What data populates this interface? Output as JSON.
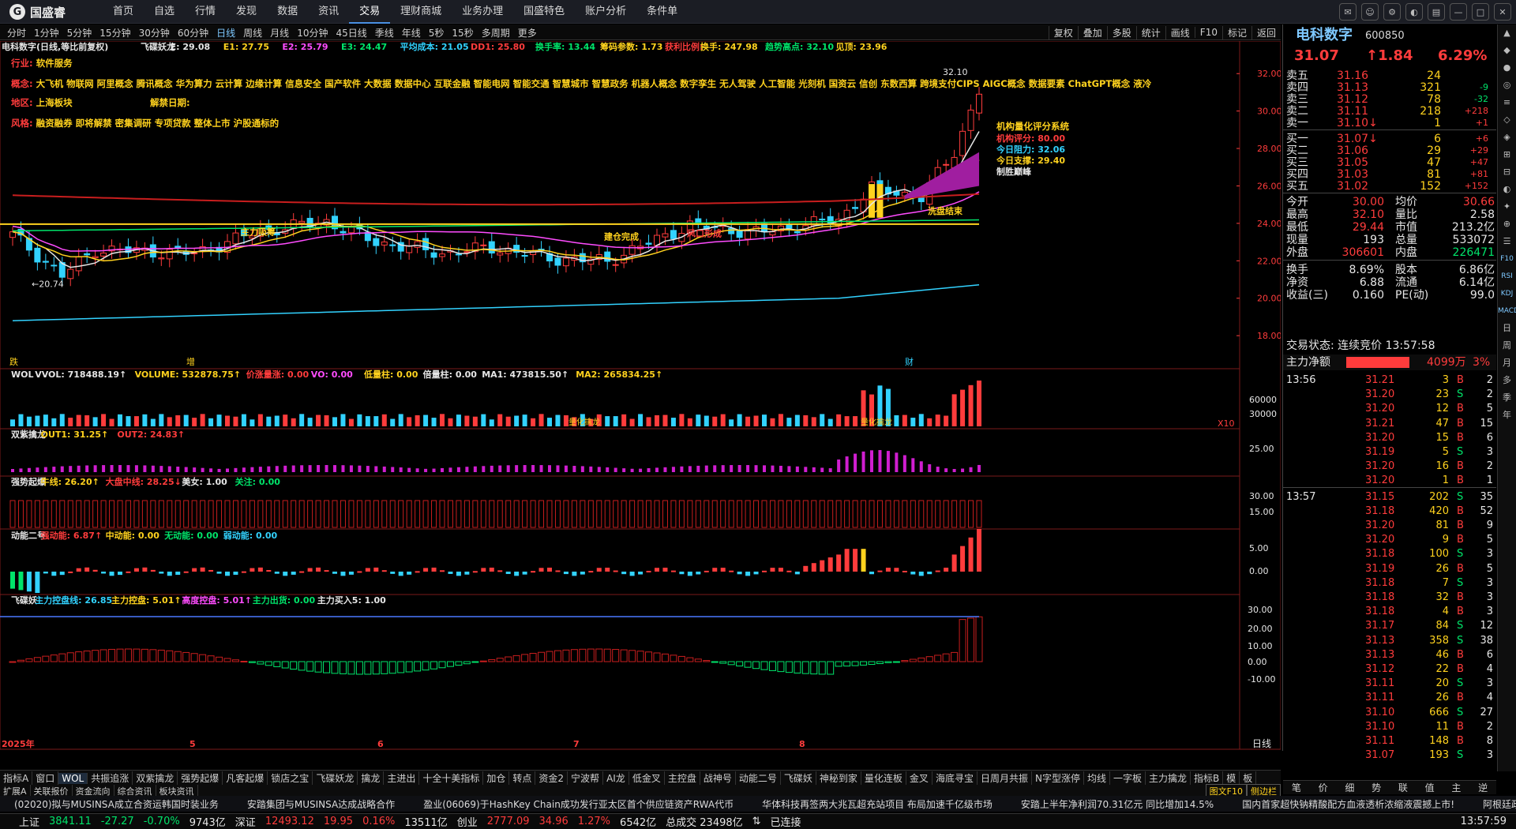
{
  "app": {
    "name": "国盛睿"
  },
  "topmenu": [
    "首页",
    "自选",
    "行情",
    "发现",
    "数据",
    "资讯",
    "交易",
    "理财商城",
    "业务办理",
    "国盛特色",
    "账户分析",
    "条件单"
  ],
  "periods": [
    "分时",
    "1分钟",
    "5分钟",
    "15分钟",
    "30分钟",
    "60分钟",
    "日线",
    "周线",
    "月线",
    "10分钟",
    "45日线",
    "季线",
    "年线",
    "5秒",
    "15秒",
    "多周期",
    "更多"
  ],
  "tools": [
    "复权",
    "叠加",
    "多股",
    "统计",
    "画线",
    "F10",
    "标记",
    "返回"
  ],
  "chart": {
    "title": "电科数字(日线,等比前复权)",
    "indicator_main": [
      {
        "t": "飞碟妖龙",
        "c": "#e6e6e6"
      },
      {
        "t": "E: 29.08",
        "c": "#e6e6e6"
      },
      {
        "t": "E1: 27.75",
        "c": "#ffd21e"
      },
      {
        "t": "E2: 25.79",
        "c": "#ff4cff"
      },
      {
        "t": "E3: 24.47",
        "c": "#00e46a"
      },
      {
        "t": "平均成本: 21.05",
        "c": "#32d2ff"
      },
      {
        "t": "DD1: 25.80",
        "c": "#ff3c3c"
      },
      {
        "t": "换手率: 13.44",
        "c": "#00e46a"
      },
      {
        "t": "筹码参数: 1.73",
        "c": "#ffd21e"
      },
      {
        "t": "获利比例:",
        "c": "#ff3c3c"
      },
      {
        "t": "换手: 247.98",
        "c": "#ffd21e"
      },
      {
        "t": "趋势高点: 32.10",
        "c": "#00e46a"
      },
      {
        "t": "见顶: 23.96",
        "c": "#ffd21e"
      }
    ],
    "info": {
      "industry": "行业: 软件服务",
      "concepts": "概念: 大飞机 物联网 阿里概念 腾讯概念 华为算力 云计算 边缘计算 信息安全 国产软件 大数据 数据中心 互联金融 智能电网 智能交通 智慧城市 智慧政务 机器人概念 数字孪生 无人驾驶 人工智能 光刻机 国资云 信创 东数西算 跨境支付CIPS AIGC概念 数据要素 ChatGPT概念 液冷",
      "region": "地区: 上海板块",
      "unlock": "解禁日期:",
      "style": "风格: 融资融券 即将解禁 密集调研 专项贷款 整体上市 沪股通标的"
    },
    "rating": {
      "title": "机构量化评分系统",
      "score": "机构评分: 80.00",
      "resist": "今日阻力: 32.06",
      "support": "今日支撑: 29.40",
      "note": "制胜巅峰"
    },
    "annotations": [
      "主力吸筹",
      "建仓完成",
      "风口形成",
      "洗盘结束",
      "←20.74",
      "32.10"
    ],
    "bottom_marks": [
      "跌",
      "增",
      "财"
    ],
    "price_axis": [
      "32.00",
      "30.00",
      "28.00",
      "26.00",
      "24.00",
      "22.00",
      "20.00",
      "18.00"
    ],
    "vol_legend": [
      {
        "t": "WOL",
        "c": "#e6e6e6"
      },
      {
        "t": "VVOL: 718488.19↑",
        "c": "#e6e6e6"
      },
      {
        "t": "VOLUME: 532878.75↑",
        "c": "#ffd21e"
      },
      {
        "t": "价涨量涨: 0.00",
        "c": "#ff3c3c"
      },
      {
        "t": "VO: 0.00",
        "c": "#ff4cff"
      },
      {
        "t": "低量柱: 0.00",
        "c": "#ffd21e"
      },
      {
        "t": "倍量柱: 0.00",
        "c": "#e6e6e6"
      },
      {
        "t": "MA1: 473815.50↑",
        "c": "#e6e6e6"
      },
      {
        "t": "MA2: 265834.25↑",
        "c": "#ffd21e"
      }
    ],
    "vol_axis": [
      "60000",
      "30000",
      "X10"
    ],
    "vol_marks": [
      "量化擒龙",
      "量化擒龙"
    ],
    "p3_legend": [
      {
        "t": "双紫擒龙",
        "c": "#e6e6e6"
      },
      {
        "t": "OUT1: 31.25↑",
        "c": "#ffd21e"
      },
      {
        "t": "OUT2: 24.83↑",
        "c": "#ff3c3c"
      }
    ],
    "p3_axis": [
      "25.00"
    ],
    "p4_legend": [
      {
        "t": "强势起爆",
        "c": "#e6e6e6"
      },
      {
        "t": "牛线: 26.20↑",
        "c": "#ffd21e"
      },
      {
        "t": "大盘中线: 28.25↓",
        "c": "#ff3c3c"
      },
      {
        "t": "美女: 1.00",
        "c": "#e6e6e6"
      },
      {
        "t": "关注: 0.00",
        "c": "#00e46a"
      }
    ],
    "p4_axis": [
      "30.00",
      "15.00"
    ],
    "p5_legend": [
      {
        "t": "动能二号",
        "c": "#e6e6e6"
      },
      {
        "t": "强动能: 6.87↑",
        "c": "#ff3c3c"
      },
      {
        "t": "中动能: 0.00",
        "c": "#ffd21e"
      },
      {
        "t": "无动能: 0.00",
        "c": "#00e46a"
      },
      {
        "t": "弱动能: 0.00",
        "c": "#32d2ff"
      }
    ],
    "p5_axis": [
      "5.00",
      "0.00"
    ],
    "p6_legend": [
      {
        "t": "飞碟妖",
        "c": "#e6e6e6"
      },
      {
        "t": "主力控盘线: 26.85",
        "c": "#32d2ff"
      },
      {
        "t": "主力控盘: 5.01↑",
        "c": "#ffd21e"
      },
      {
        "t": "高度控盘: 5.01↑",
        "c": "#ff4cff"
      },
      {
        "t": "主力出货: 0.00",
        "c": "#00e46a"
      },
      {
        "t": "主力买入5: 1.00",
        "c": "#e6e6e6"
      }
    ],
    "p6_axis": [
      "30.00",
      "20.00",
      "10.00",
      "0.00",
      "-10.00"
    ],
    "date_axis": [
      "2025年",
      "5",
      "6",
      "7",
      "8"
    ],
    "period_label": "日线"
  },
  "quote": {
    "name": "电科数字",
    "code": "600850",
    "price": "31.07",
    "change": "↑1.84",
    "pct": "6.29%",
    "asks": [
      {
        "l": "卖五",
        "p": "31.16",
        "v": "24",
        "d": ""
      },
      {
        "l": "卖四",
        "p": "31.13",
        "v": "321",
        "d": "-9"
      },
      {
        "l": "卖三",
        "p": "31.12",
        "v": "78",
        "d": "-32"
      },
      {
        "l": "卖二",
        "p": "31.11",
        "v": "218",
        "d": "+218"
      },
      {
        "l": "卖一",
        "p": "31.10↓",
        "v": "1",
        "d": "+1"
      }
    ],
    "bids": [
      {
        "l": "买一",
        "p": "31.07↓",
        "v": "6",
        "d": "+6"
      },
      {
        "l": "买二",
        "p": "31.06",
        "v": "29",
        "d": "+29"
      },
      {
        "l": "买三",
        "p": "31.05",
        "v": "47",
        "d": "+47"
      },
      {
        "l": "买四",
        "p": "31.03",
        "v": "81",
        "d": "+81"
      },
      {
        "l": "买五",
        "p": "31.02",
        "v": "152",
        "d": "+152"
      }
    ],
    "stats": [
      [
        "今开",
        "30.00",
        "均价",
        "30.66"
      ],
      [
        "最高",
        "32.10",
        "量比",
        "2.58"
      ],
      [
        "最低",
        "29.44",
        "市值",
        "213.2亿"
      ],
      [
        "现量",
        "193",
        "总量",
        "533072"
      ],
      [
        "外盘",
        "306601",
        "内盘",
        "226471"
      ]
    ],
    "stats2": [
      [
        "换手",
        "8.69%",
        "股本",
        "6.86亿"
      ],
      [
        "净资",
        "6.88",
        "流通",
        "6.14亿"
      ],
      [
        "收益(三)",
        "0.160",
        "PE(动)",
        "99.0"
      ]
    ],
    "status": "交易状态: 连续竞价 13:57:58",
    "netflow_label": "主力净额",
    "netflow_value": "4099万",
    "netflow_pct": "3%",
    "ticks": [
      {
        "t": "13:56",
        "p": "31.21",
        "v": "3",
        "s": "B",
        "n": "2"
      },
      {
        "t": "",
        "p": "31.20",
        "v": "23",
        "s": "S",
        "n": "2"
      },
      {
        "t": "",
        "p": "31.20",
        "v": "12",
        "s": "B",
        "n": "5"
      },
      {
        "t": "",
        "p": "31.21",
        "v": "47",
        "s": "B",
        "n": "15"
      },
      {
        "t": "",
        "p": "31.20",
        "v": "15",
        "s": "B",
        "n": "6"
      },
      {
        "t": "",
        "p": "31.19",
        "v": "5",
        "s": "S",
        "n": "3"
      },
      {
        "t": "",
        "p": "31.20",
        "v": "16",
        "s": "B",
        "n": "2"
      },
      {
        "t": "",
        "p": "31.20",
        "v": "1",
        "s": "B",
        "n": "1"
      },
      {
        "t": "13:57",
        "p": "31.15",
        "v": "202",
        "s": "S",
        "n": "35"
      },
      {
        "t": "",
        "p": "31.18",
        "v": "420",
        "s": "B",
        "n": "52"
      },
      {
        "t": "",
        "p": "31.20",
        "v": "81",
        "s": "B",
        "n": "9"
      },
      {
        "t": "",
        "p": "31.20",
        "v": "9",
        "s": "B",
        "n": "5"
      },
      {
        "t": "",
        "p": "31.18",
        "v": "100",
        "s": "S",
        "n": "3"
      },
      {
        "t": "",
        "p": "31.19",
        "v": "26",
        "s": "B",
        "n": "5"
      },
      {
        "t": "",
        "p": "31.18",
        "v": "7",
        "s": "S",
        "n": "3"
      },
      {
        "t": "",
        "p": "31.18",
        "v": "32",
        "s": "B",
        "n": "3"
      },
      {
        "t": "",
        "p": "31.18",
        "v": "4",
        "s": "B",
        "n": "3"
      },
      {
        "t": "",
        "p": "31.17",
        "v": "84",
        "s": "S",
        "n": "12"
      },
      {
        "t": "",
        "p": "31.13",
        "v": "358",
        "s": "S",
        "n": "38"
      },
      {
        "t": "",
        "p": "31.13",
        "v": "46",
        "s": "B",
        "n": "6"
      },
      {
        "t": "",
        "p": "31.12",
        "v": "22",
        "s": "B",
        "n": "4"
      },
      {
        "t": "",
        "p": "31.11",
        "v": "20",
        "s": "S",
        "n": "3"
      },
      {
        "t": "",
        "p": "31.11",
        "v": "26",
        "s": "B",
        "n": "4"
      },
      {
        "t": "",
        "p": "31.10",
        "v": "666",
        "s": "S",
        "n": "27"
      },
      {
        "t": "",
        "p": "31.10",
        "v": "11",
        "s": "B",
        "n": "2"
      },
      {
        "t": "",
        "p": "31.11",
        "v": "148",
        "s": "B",
        "n": "8"
      },
      {
        "t": "",
        "p": "31.07",
        "v": "193",
        "s": "S",
        "n": "3"
      }
    ],
    "bottom_tabs": [
      "笔",
      "价",
      "细",
      "势",
      "联",
      "值",
      "主",
      "逆"
    ]
  },
  "sidestrip": [
    "日",
    "周",
    "月",
    "多",
    "季",
    "年"
  ],
  "sidestrip_icons": [
    "F10",
    "RSI",
    "KDJ",
    "MACD"
  ],
  "indicator_tabs": [
    "指标A",
    "窗口",
    "WOL",
    "共振追涨",
    "双紫擒龙",
    "强势起爆",
    "凡客起爆",
    "锁店之宝",
    "飞碟妖龙",
    "擒龙",
    "主进出",
    "十全十美指标",
    "加仓",
    "转点",
    "资金2",
    "宁波帮",
    "AI龙",
    "低金叉",
    "主控盘",
    "战神号",
    "动能二号",
    "飞碟妖",
    "神秘到家",
    "量化连板",
    "金叉",
    "海底寻宝",
    "日周月共振",
    "N字型涨停",
    "均线",
    "一字板",
    "主力擒龙",
    "指标B",
    "模",
    "板"
  ],
  "subtabs": [
    "扩展A",
    "关联报价",
    "资金流向",
    "综合资讯",
    "板块资讯"
  ],
  "right_tabs_bottom": [
    "图文F10",
    "侧边栏"
  ],
  "news": [
    "(02020)拟与MUSINSA成立合资运韩国时装业务",
    "安踏集团与MUSINSA达成战略合作",
    "盈业(06069)于HashKey Chain成功发行亚太区首个供应链资产RWA代币",
    "华体科技再签两大兆瓦超充站项目 布局加速千亿级市场",
    "安踏上半年净利润70.31亿元 同比增加14.5%",
    "国内首家超快钠精酸配方血液透析浓缩液震撼上市!",
    "阿根廷政府"
  ],
  "status": {
    "sh": {
      "label": "上证",
      "price": "3841.11",
      "chg": "-27.27",
      "pct": "-0.70%",
      "amt": "9743亿"
    },
    "sz": {
      "label": "深证",
      "price": "12493.12",
      "chg": "19.95",
      "pct": "0.16%",
      "amt": "13511亿"
    },
    "cy": {
      "label": "创业",
      "price": "2777.09",
      "chg": "34.96",
      "pct": "1.27%",
      "amt": "6542亿"
    },
    "total": "总成交 23498亿",
    "conn": "已连接",
    "time": "13:57:59"
  },
  "colors": {
    "up": "#ff3c3c",
    "down": "#00e46a",
    "neutral": "#e6e6e6",
    "accent": "#ffd21e"
  }
}
